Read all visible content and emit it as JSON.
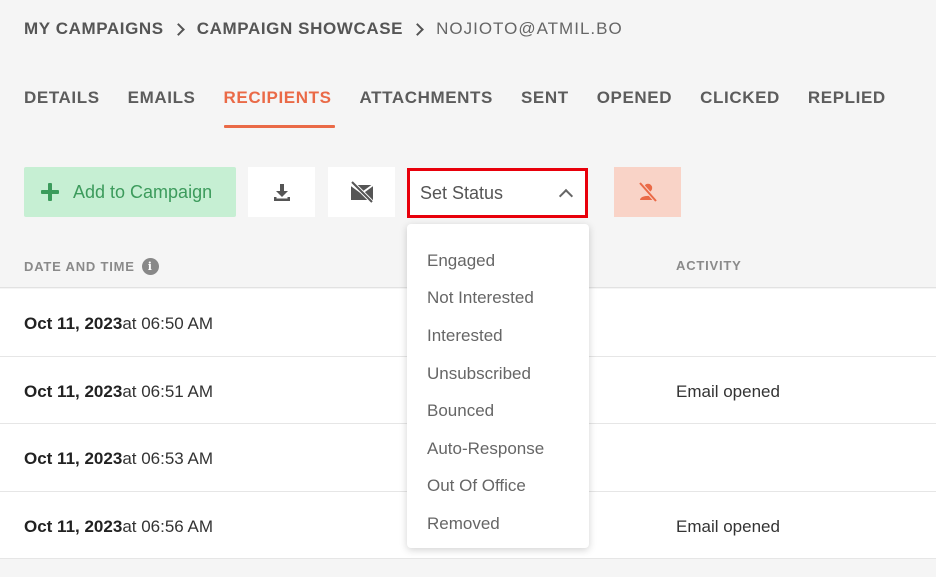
{
  "breadcrumb": {
    "items": [
      "MY CAMPAIGNS",
      "CAMPAIGN SHOWCASE"
    ],
    "current": "NOJIOTO@ATMIL.BO"
  },
  "tabs": [
    {
      "label": "DETAILS"
    },
    {
      "label": "EMAILS"
    },
    {
      "label": "RECIPIENTS",
      "active": true
    },
    {
      "label": "ATTACHMENTS"
    },
    {
      "label": "SENT"
    },
    {
      "label": "OPENED"
    },
    {
      "label": "CLICKED"
    },
    {
      "label": "REPLIED"
    }
  ],
  "toolbar": {
    "add_label": "Add to Campaign",
    "download_icon": "download-icon",
    "mail_off_icon": "mail-off-icon",
    "status_label": "Set Status",
    "remove_icon": "user-remove-icon"
  },
  "table": {
    "headers": {
      "date": "DATE AND TIME",
      "activity": "ACTIVITY"
    },
    "rows": [
      {
        "date": "Oct 11, 2023",
        "time": "at 06:50 AM",
        "activity": ""
      },
      {
        "date": "Oct 11, 2023",
        "time": "at 06:51 AM",
        "activity": "Email opened"
      },
      {
        "date": "Oct 11, 2023",
        "time": "at 06:53 AM",
        "activity": ""
      },
      {
        "date": "Oct 11, 2023",
        "time": "at 06:56 AM",
        "activity": "Email opened"
      }
    ]
  },
  "status_menu": {
    "options": [
      "Engaged",
      "Not Interested",
      "Interested",
      "Unsubscribed",
      "Bounced",
      "Auto-Response",
      "Out Of Office",
      "Removed"
    ]
  },
  "colors": {
    "accent": "#ea6a47",
    "add_bg": "#c6efd3",
    "add_text": "#3c9b5c",
    "highlight_border": "#e8000b",
    "remove_bg": "#f9d3c7"
  }
}
